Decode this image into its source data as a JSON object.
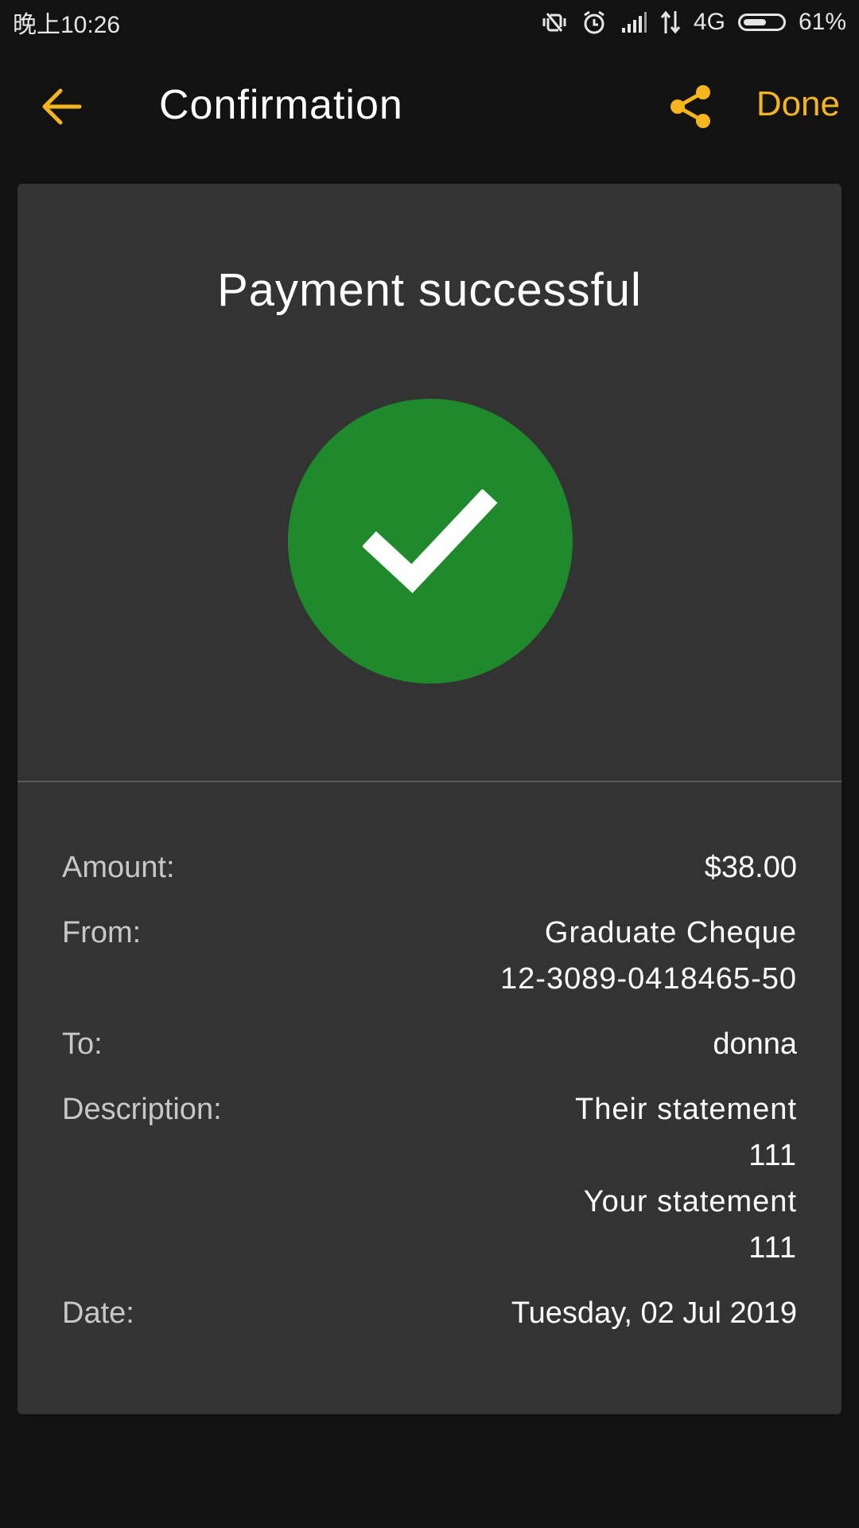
{
  "status_bar": {
    "time": "晚上10:26",
    "network": "4G",
    "battery": "61%",
    "battery_level": 0.61,
    "icons": [
      "mute-vibrate-icon",
      "alarm-icon",
      "signal-icon",
      "data-arrows-icon",
      "battery-icon"
    ]
  },
  "app_bar": {
    "title": "Confirmation",
    "back_icon": "arrow-left-icon",
    "share_icon": "share-icon",
    "done_label": "Done"
  },
  "card": {
    "title": "Payment successful",
    "status_icon": "check-icon",
    "status_color": "#1f8a2b"
  },
  "details": {
    "amount": {
      "label": "Amount:",
      "value": "$38.00"
    },
    "from": {
      "label": "From:",
      "account_name": "Graduate Cheque",
      "account_number": "12-3089-0418465-50"
    },
    "to": {
      "label": "To:",
      "value": "donna"
    },
    "description": {
      "label": "Description:",
      "their_label": "Their statement",
      "their_value": "111",
      "your_label": "Your statement",
      "your_value": "111"
    },
    "date": {
      "label": "Date:",
      "value": "Tuesday, 02 Jul 2019"
    }
  },
  "colors": {
    "accent": "#f5b51b",
    "background": "#121212",
    "card": "#333333",
    "success": "#1f8a2b"
  }
}
